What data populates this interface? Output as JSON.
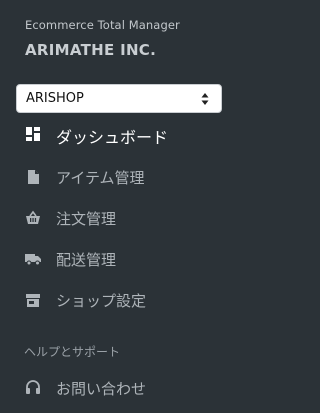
{
  "header": {
    "app_name": "Ecommerce Total Manager",
    "company": "ARIMATHE INC."
  },
  "store_select": {
    "value": "ARISHOP"
  },
  "nav": {
    "items": [
      {
        "label": "ダッシュボード",
        "icon": "dashboard-icon",
        "active": true
      },
      {
        "label": "アイテム管理",
        "icon": "file-icon",
        "active": false
      },
      {
        "label": "注文管理",
        "icon": "shopping-basket-icon",
        "active": false
      },
      {
        "label": "配送管理",
        "icon": "truck-icon",
        "active": false
      },
      {
        "label": "ショップ設定",
        "icon": "store-icon",
        "active": false
      }
    ]
  },
  "help": {
    "section_title": "ヘルプとサポート",
    "contact_label": "お問い合わせ",
    "contact_icon": "headset-icon"
  },
  "colors": {
    "background": "#2b3237",
    "active_text": "#ffffff",
    "inactive_text": "#aeb4b9"
  }
}
